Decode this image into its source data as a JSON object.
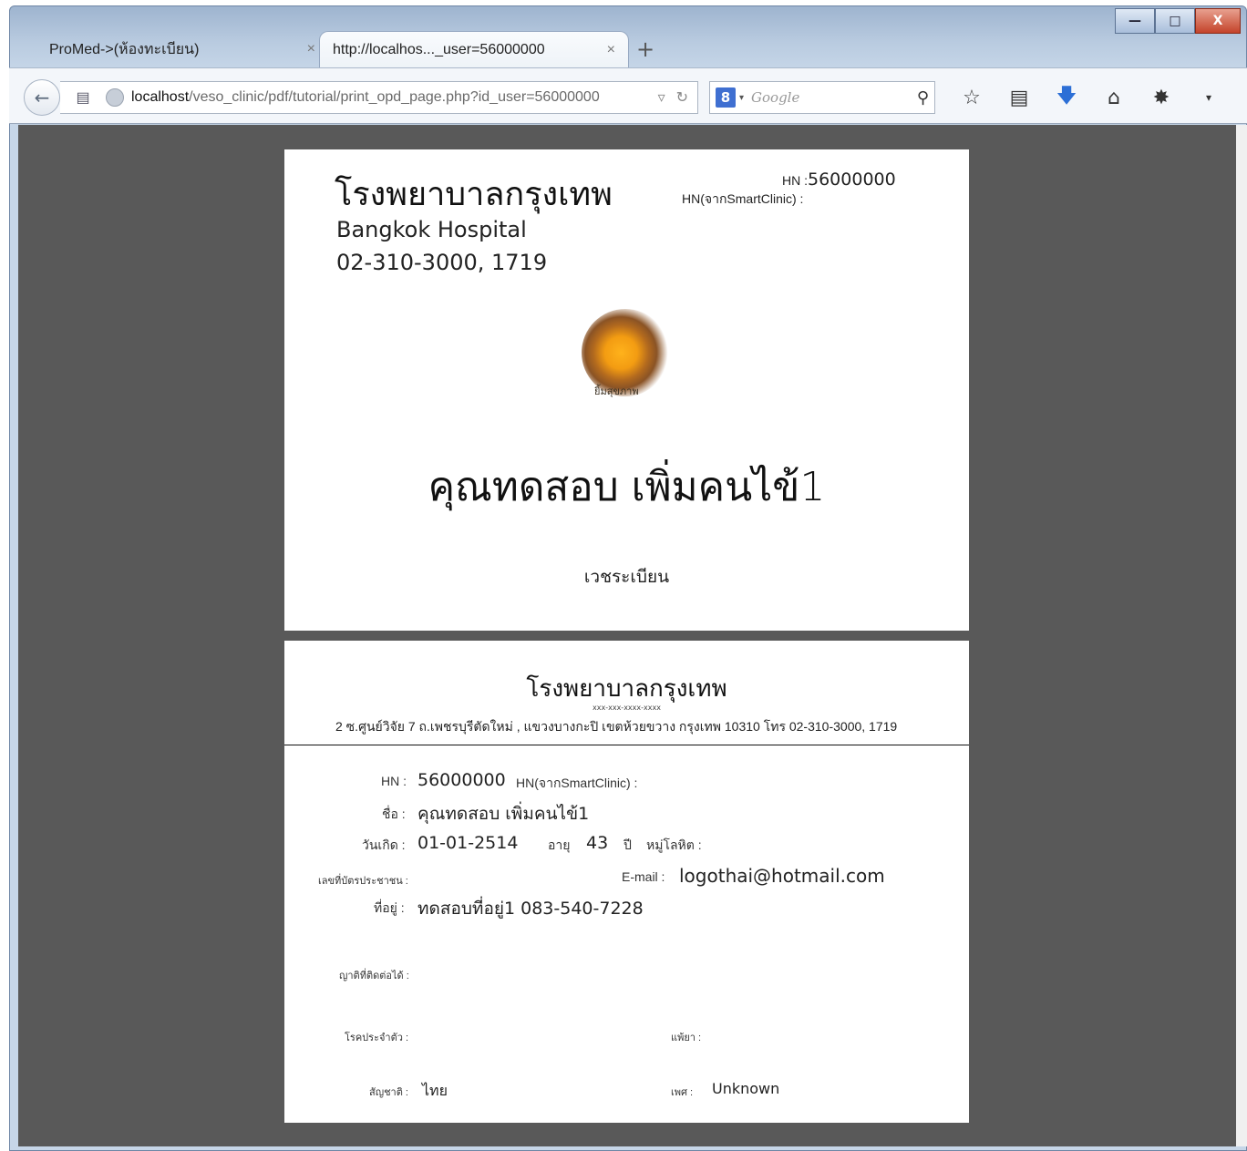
{
  "browser": {
    "tabs": [
      {
        "label": "ProMed->(ห้องทะเบียน)",
        "close": "×"
      },
      {
        "label": "http://localhos..._user=56000000",
        "close": "×"
      }
    ],
    "new_tab": "+",
    "url_host": "localhost",
    "url_path": "/veso_clinic/pdf/tutorial/print_opd_page.php?id_user=56000000",
    "search_engine_icon": "8",
    "search_placeholder": "Google",
    "window_controls": {
      "minimize": "—",
      "maximize": "□",
      "close": "X"
    }
  },
  "card": {
    "hospital_thai": "โรงพยาบาลกรุงเทพ",
    "hospital_en": "Bangkok Hospital",
    "phone": "02-310-3000, 1719",
    "hn_label": "HN :",
    "hn_value": "56000000",
    "hn_smart_label": "HN(จากSmartClinic) :",
    "logo_text": "ยิ้มสุขภาพ",
    "patient_name": "คุณทดสอบ เพิ่มคนไข้1",
    "department": "เวชระเบียน"
  },
  "record": {
    "hospital_thai": "โรงพยาบาลกรุงเทพ",
    "id_placeholder": "xxx-xxx-xxxx-xxxx",
    "address_line": "2 ซ.ศูนย์วิจัย 7 ถ.เพชรบุรีตัดใหม่ , แขวงบางกะปิ เขตห้วยขวาง กรุงเทพ 10310 โทร 02-310-3000, 1719",
    "hn_label": "HN :",
    "hn_value": "56000000",
    "hn_smart_label": "HN(จากSmartClinic) :",
    "name_label": "ชื่อ :",
    "name_value": "คุณทดสอบ เพิ่มคนไข้1",
    "dob_label": "วันเกิด :",
    "dob_value": "01-01-2514",
    "age_label": "อายุ",
    "age_value": "43",
    "age_unit": "ปี",
    "blood_label": "หมู่โลหิต :",
    "citizen_label": "เลขที่บัตรประชาชน :",
    "email_label": "E-mail :",
    "email_value": "logothai@hotmail.com",
    "address_label": "ที่อยู่ :",
    "address_value": "ทดสอบที่อยู่1 083-540-7228",
    "relative_label": "ญาติที่ติดต่อได้ :",
    "disease_label": "โรคประจำตัว :",
    "allergy_label": "แพ้ยา :",
    "nationality_label": "สัญชาติ :",
    "nationality_value": "ไทย",
    "sex_label": "เพศ :",
    "sex_value": "Unknown"
  }
}
